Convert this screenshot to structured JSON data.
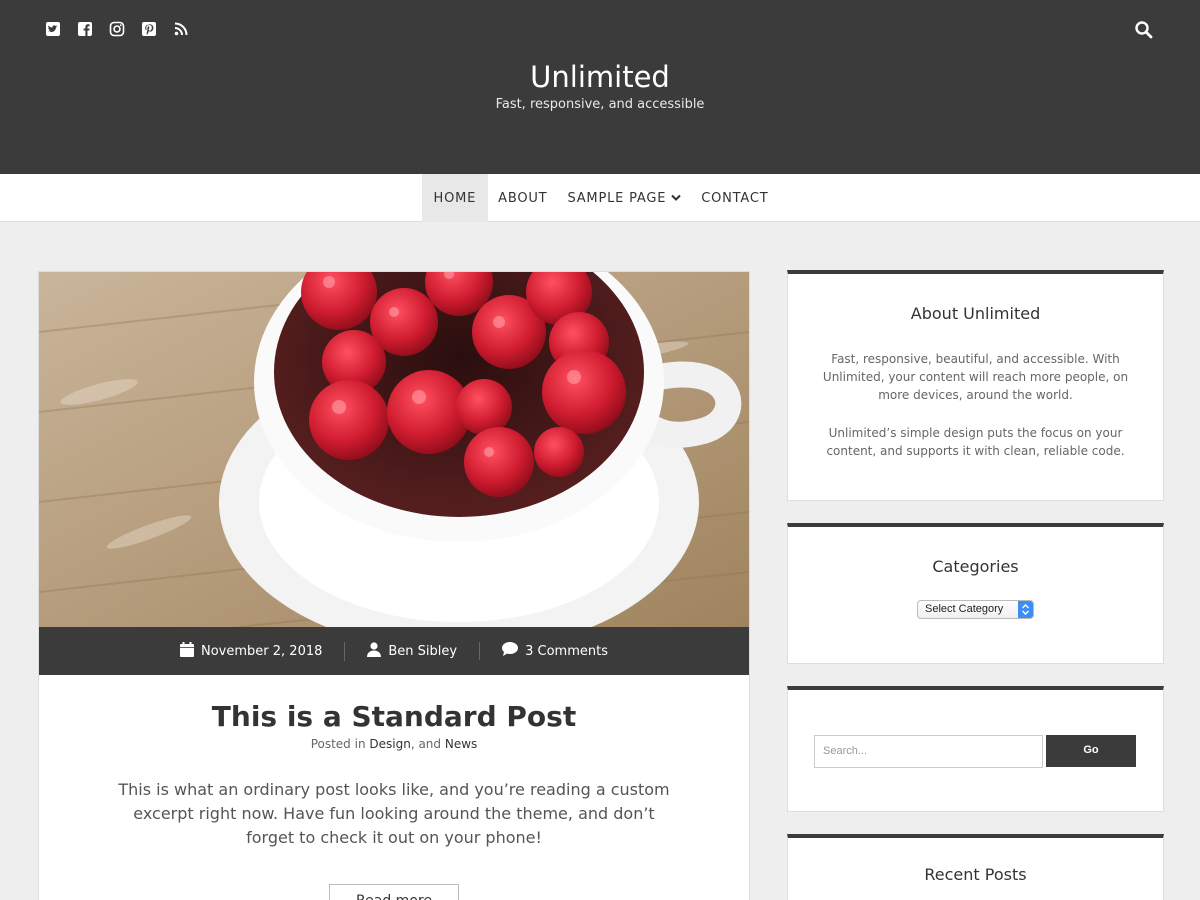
{
  "header": {
    "title": "Unlimited",
    "tagline": "Fast, responsive, and accessible",
    "social_icons": [
      "twitter-icon",
      "facebook-icon",
      "instagram-icon",
      "pinterest-icon",
      "rss-icon"
    ]
  },
  "nav": {
    "items": [
      {
        "label": "HOME",
        "active": true
      },
      {
        "label": "ABOUT"
      },
      {
        "label": "SAMPLE PAGE",
        "has_submenu": true
      },
      {
        "label": "CONTACT"
      }
    ]
  },
  "post": {
    "date": "November 2, 2018",
    "author": "Ben Sibley",
    "comments": "3 Comments",
    "title": "This is a Standard Post",
    "posted_in_prefix": "Posted in",
    "category1": "Design",
    "separator": ", and",
    "category2": "News",
    "excerpt": "This is what an ordinary post looks like, and you’re reading a custom excerpt right now. Have fun looking around the theme, and don’t forget to check it out on your phone!",
    "read_more": "Read more"
  },
  "sidebar": {
    "about": {
      "title": "About Unlimited",
      "p1": "Fast, responsive, beautiful, and accessible. With Unlimited, your content will reach more people, on more devices, around the world.",
      "p2": "Unlimited’s simple design puts the focus on your content, and supports it with clean, reliable code."
    },
    "categories": {
      "title": "Categories",
      "select_value": "Select Category"
    },
    "search": {
      "placeholder": "Search...",
      "button": "Go"
    },
    "recent": {
      "title": "Recent Posts"
    }
  },
  "colors": {
    "header_bg": "#3b3b3b",
    "page_bg": "#eeeeee",
    "accent_select": "#3d8df5"
  }
}
